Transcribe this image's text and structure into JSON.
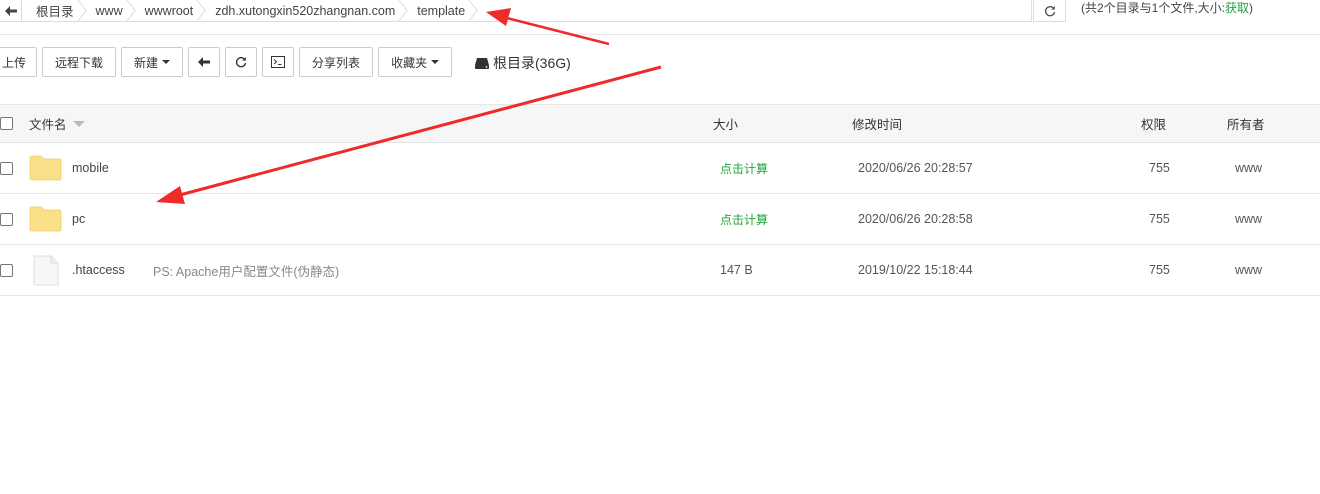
{
  "breadcrumb": {
    "items": [
      "根目录",
      "www",
      "wwwroot",
      "zdh.xutongxin520zhangnan.com",
      "template"
    ]
  },
  "summary": {
    "text": "(共2个目录与1个文件,大小:",
    "link": "获取",
    "close": ")"
  },
  "toolbar": {
    "upload": "上传",
    "remote_download": "远程下载",
    "new": "新建",
    "share_list": "分享列表",
    "favorites": "收藏夹",
    "disk_label": "根目录(36G)"
  },
  "table": {
    "headers": {
      "name": "文件名",
      "size": "大小",
      "modified": "修改时间",
      "perm": "权限",
      "owner": "所有者"
    },
    "rows": [
      {
        "type": "folder",
        "name": "mobile",
        "note": "",
        "size": "点击计算",
        "modified": "2020/06/26 20:28:57",
        "perm": "755",
        "owner": "www"
      },
      {
        "type": "folder",
        "name": "pc",
        "note": "",
        "size": "点击计算",
        "modified": "2020/06/26 20:28:58",
        "perm": "755",
        "owner": "www"
      },
      {
        "type": "file",
        "name": ".htaccess",
        "note": "PS: Apache用户配置文件(伪静态)",
        "size": "147 B",
        "modified": "2019/10/22 15:18:44",
        "perm": "755",
        "owner": "www"
      }
    ]
  },
  "colors": {
    "accent_green": "#20a53a",
    "folder": "#fbe08a",
    "annotation_arrow": "#ee2a2a"
  }
}
